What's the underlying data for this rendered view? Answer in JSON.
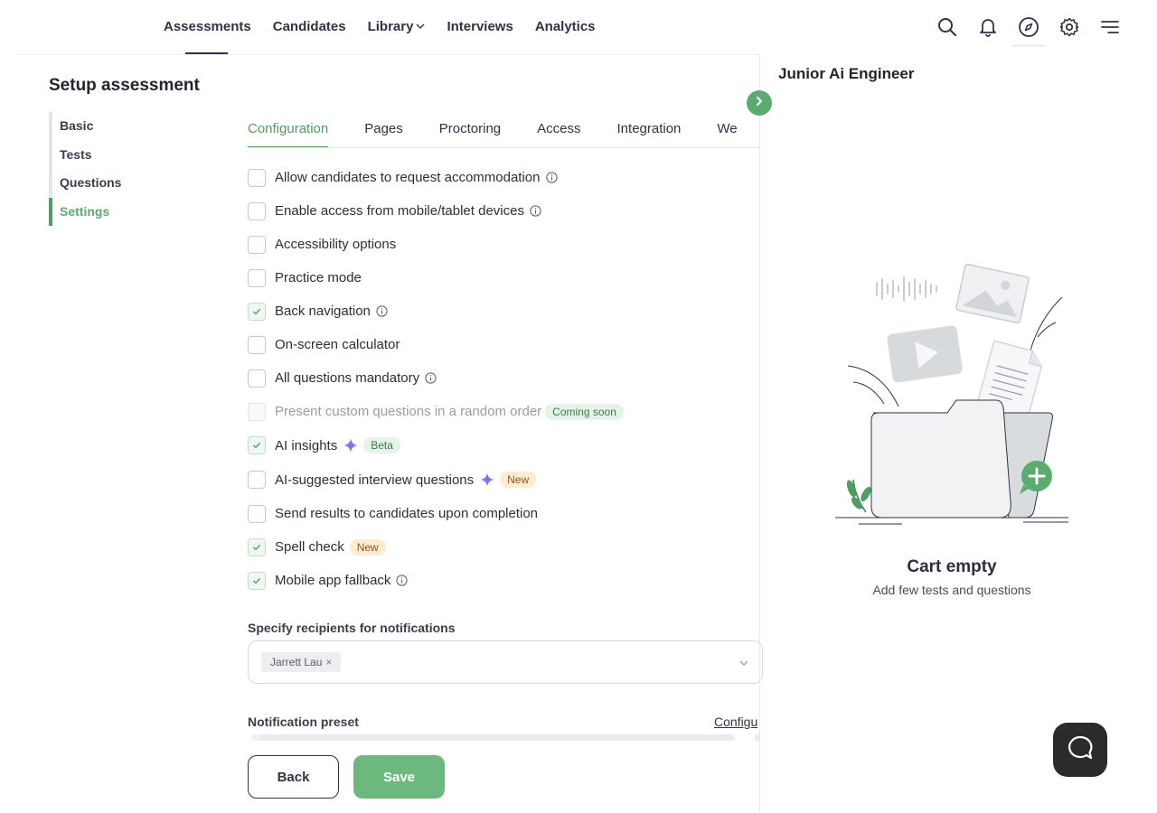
{
  "nav": {
    "links": [
      {
        "label": "Assessments"
      },
      {
        "label": "Candidates"
      },
      {
        "label": "Library"
      },
      {
        "label": "Interviews"
      },
      {
        "label": "Analytics"
      }
    ],
    "icons": [
      "search-icon",
      "bell-icon",
      "compass-icon",
      "gear-icon",
      "menu-icon"
    ]
  },
  "setup": {
    "title": "Setup assessment",
    "menu": [
      {
        "label": "Basic"
      },
      {
        "label": "Tests"
      },
      {
        "label": "Questions"
      },
      {
        "label": "Settings"
      }
    ],
    "active_menu": "Settings"
  },
  "tabs": [
    {
      "label": "Configuration"
    },
    {
      "label": "Pages"
    },
    {
      "label": "Proctoring"
    },
    {
      "label": "Access"
    },
    {
      "label": "Integration"
    },
    {
      "label": "We"
    }
  ],
  "options": [
    {
      "label": "Allow candidates to request accommodation",
      "checked": false,
      "info": true
    },
    {
      "label": "Enable access from mobile/tablet devices",
      "checked": false,
      "info": true
    },
    {
      "label": "Accessibility options",
      "checked": false
    },
    {
      "label": "Practice mode",
      "checked": false
    },
    {
      "label": "Back navigation",
      "checked": true,
      "info": true
    },
    {
      "label": "On-screen calculator",
      "checked": false
    },
    {
      "label": "All questions mandatory",
      "checked": false,
      "info": true
    },
    {
      "label": "Present custom questions in a random order",
      "checked": false,
      "disabled": true,
      "badge": "Coming soon"
    },
    {
      "label": "AI insights",
      "checked": true,
      "sparkle": true,
      "badge": "Beta"
    },
    {
      "label": "AI-suggested interview questions",
      "checked": false,
      "sparkle": true,
      "badge": "New"
    },
    {
      "label": "Send results to candidates upon completion",
      "checked": false
    },
    {
      "label": "Spell check",
      "checked": true,
      "badge": "New"
    },
    {
      "label": "Mobile app fallback",
      "checked": true,
      "info": true
    }
  ],
  "recipients": {
    "label": "Specify recipients for notifications",
    "chips": [
      "Jarrett Lau"
    ],
    "chip_remove": "×"
  },
  "preset": {
    "label": "Notification preset",
    "configure_link": "Configu"
  },
  "buttons": {
    "back": "Back",
    "save": "Save"
  },
  "cart": {
    "title": "Junior Ai Engineer",
    "empty_title": "Cart empty",
    "empty_sub": "Add few tests and questions"
  },
  "colors": {
    "accent": "#4e9d62",
    "save_button": "#6db87d",
    "text": "#2f3345"
  }
}
